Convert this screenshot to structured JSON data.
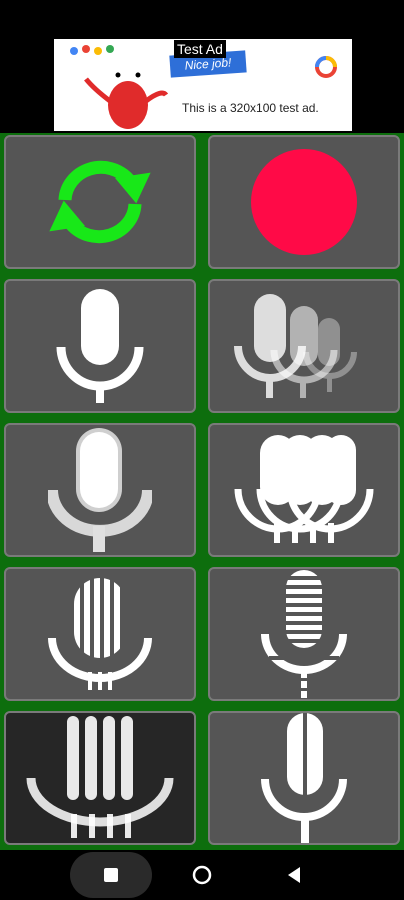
{
  "ad": {
    "tag": "Test Ad",
    "banner_text": "Nice job!",
    "body_text": "This is a 320x100 test ad."
  },
  "colors": {
    "grid_background": "#0d6e0d",
    "tile": "#555555",
    "tile_dark": "#262626",
    "refresh_icon": "#18e818",
    "record_icon": "#ff0a47"
  },
  "tiles": [
    {
      "icon": "refresh-icon"
    },
    {
      "icon": "record-icon"
    },
    {
      "icon": "microphone-icon"
    },
    {
      "icon": "microphone-echo-icon"
    },
    {
      "icon": "microphone-3d-icon"
    },
    {
      "icon": "microphone-multi-icon"
    },
    {
      "icon": "microphone-vertical-stripes-icon"
    },
    {
      "icon": "microphone-horizontal-stripes-icon"
    },
    {
      "icon": "microphone-blur-icon"
    },
    {
      "icon": "microphone-split-icon"
    }
  ],
  "navbar": {
    "buttons": [
      "recents-icon",
      "home-icon",
      "back-icon"
    ]
  }
}
